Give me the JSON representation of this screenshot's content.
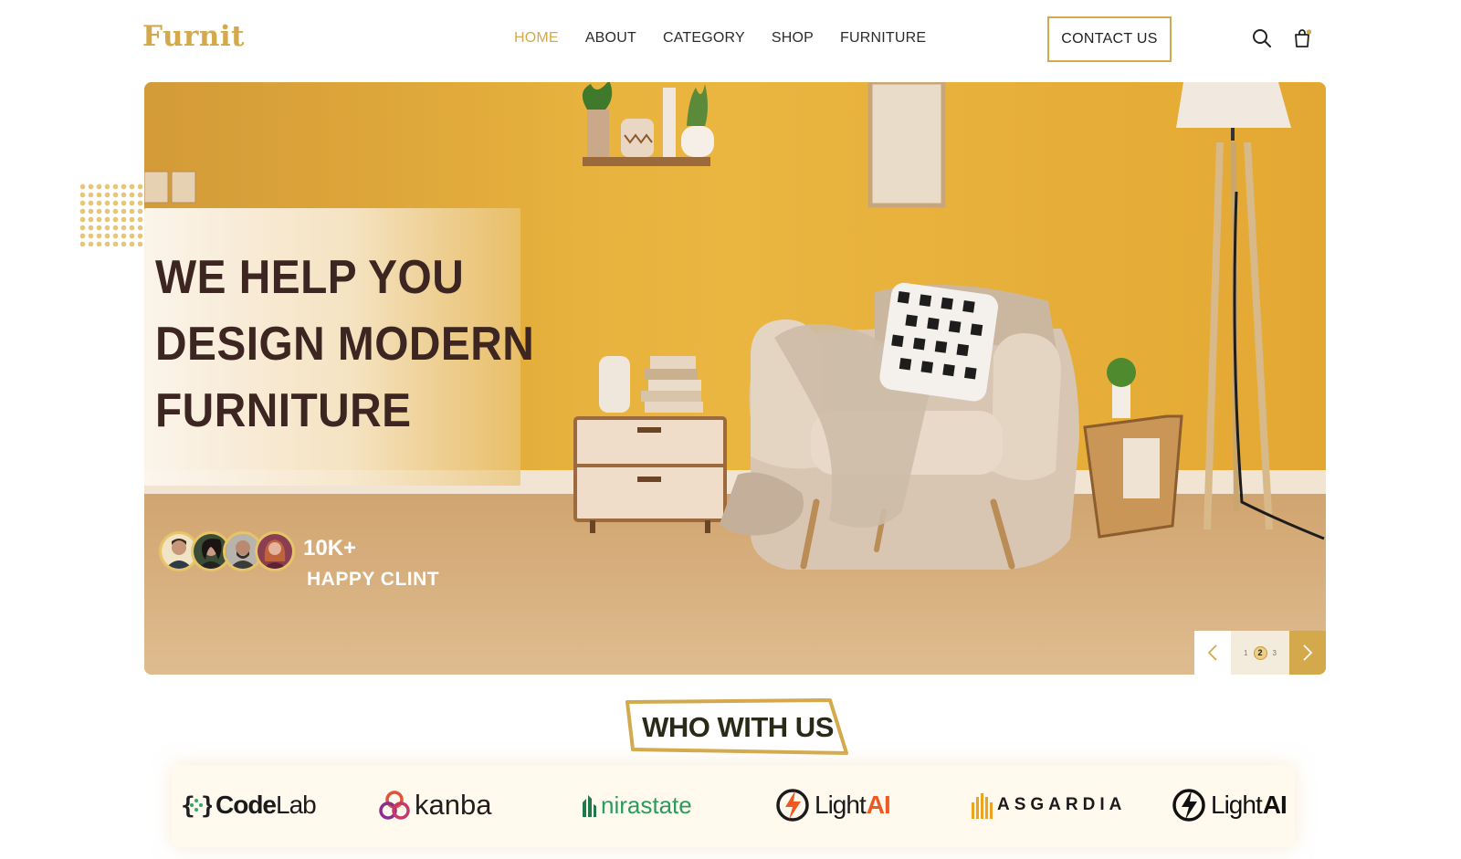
{
  "brand": {
    "name": "Furnit",
    "accent": "#d4a94b"
  },
  "nav": {
    "items": [
      {
        "label": "HOME",
        "active": true
      },
      {
        "label": "ABOUT",
        "active": false
      },
      {
        "label": "CATEGORY",
        "active": false
      },
      {
        "label": "SHOP",
        "active": false
      },
      {
        "label": "FURNITURE",
        "active": false
      }
    ],
    "contact_label": "CONTACT US",
    "icons": [
      "search-icon",
      "shopping-bag-icon"
    ]
  },
  "hero": {
    "headline": [
      "WE HELP YOU",
      "DESIGN MODERN",
      "FURNITURE"
    ],
    "happy_count": "10K+",
    "happy_label": "HAPPY CLINT",
    "pager": {
      "pages": [
        "1",
        "2",
        "3"
      ],
      "current": "2"
    }
  },
  "partners_section": {
    "title": "WHO WITH US",
    "logos": [
      {
        "name": "codelab",
        "text_a": "Code",
        "text_b": "Lab"
      },
      {
        "name": "kanba",
        "text": "kanba"
      },
      {
        "name": "nirastate",
        "text": "nirastate"
      },
      {
        "name": "lightai-1",
        "text_a": "Light",
        "text_b": "AI"
      },
      {
        "name": "asgardia",
        "text": "ASGARDIA"
      },
      {
        "name": "lightai-2",
        "text_a": "Light",
        "text_b": "AI"
      }
    ]
  }
}
